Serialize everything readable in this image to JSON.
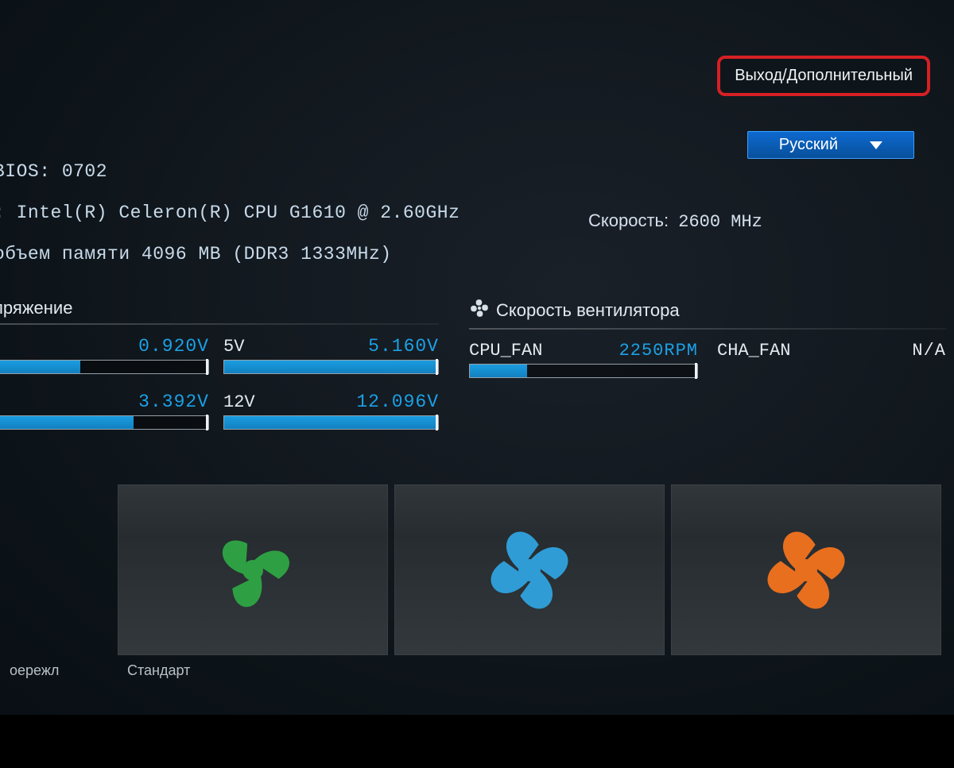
{
  "top": {
    "exit_advanced": "Выход/Дополнительный"
  },
  "language": {
    "selected": "Русский"
  },
  "sys": {
    "bios_line": "BIOS: 0702",
    "cpu_line": ": Intel(R) Celeron(R) CPU G1610 @ 2.60GHz",
    "mem_line": "объем памяти 4096 MB (DDR3 1333MHz)"
  },
  "speed": {
    "label": "Скорость:",
    "value": "2600 MHz"
  },
  "voltage": {
    "title": "пряжение",
    "cells": [
      {
        "name": "",
        "value": "0.920V",
        "fill": 40
      },
      {
        "name": "5V",
        "value": "5.160V",
        "fill": 100
      },
      {
        "name": "",
        "value": "3.392V",
        "fill": 65
      },
      {
        "name": "12V",
        "value": "12.096V",
        "fill": 100
      }
    ]
  },
  "fan": {
    "title": "Скорость вентилятора",
    "cells": [
      {
        "name": "CPU_FAN",
        "value": "2250RPM",
        "fill": 25,
        "na": false
      },
      {
        "name": "CHA_FAN",
        "value": "N/A",
        "fill": 0,
        "na": true
      }
    ]
  },
  "modes": {
    "cut_label": "оережл",
    "labels": [
      "Стандарт",
      "",
      ""
    ]
  },
  "colors": {
    "mode_green": "#2ea043",
    "mode_blue": "#2f9cd6",
    "mode_orange": "#e86f1e"
  }
}
